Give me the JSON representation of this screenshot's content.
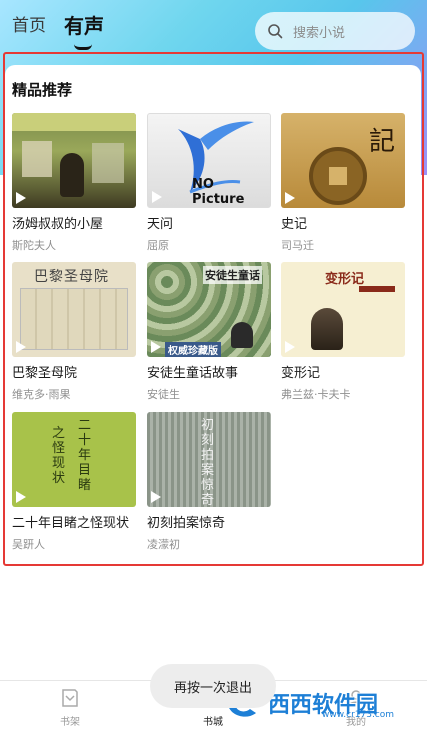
{
  "header": {
    "tab_home": "首页",
    "tab_audio": "有声",
    "search_placeholder": "搜索小说"
  },
  "section": {
    "title": "精品推荐"
  },
  "books": [
    {
      "title": "汤姆叔叔的小屋",
      "author": "斯陀夫人"
    },
    {
      "title": "天问",
      "author": "屈原",
      "cover_text": "NO Picture"
    },
    {
      "title": "史记",
      "author": "司马迁",
      "cover_text": "記"
    },
    {
      "title": "巴黎圣母院",
      "author": "维克多·雨果",
      "cover_text": "巴黎圣母院"
    },
    {
      "title": "安徒生童话故事",
      "author": "安徒生",
      "cover_text": "安徒生童话",
      "cover_subtext": "权威珍藏版"
    },
    {
      "title": "变形记",
      "author": "弗兰兹·卡夫卡",
      "cover_text": "变形记"
    },
    {
      "title": "二十年目睹之怪现状",
      "author": "吴趼人",
      "cover_text_1": "二十年目睹",
      "cover_text_2": "之怪现状"
    },
    {
      "title": "初刻拍案惊奇",
      "author": "凌濛初",
      "cover_text": "初刻拍案惊奇"
    }
  ],
  "toast": {
    "text": "再按一次退出"
  },
  "bottom_nav": {
    "bookshelf": "书架",
    "bookstore": "书城",
    "mine": "我的"
  },
  "watermark": {
    "text": "西西软件园",
    "url": "www.cr173.com"
  },
  "colors": {
    "highlight_border": "#e53935",
    "header_gradient_start": "#a8e6ff",
    "header_gradient_end": "#9d8ff6"
  }
}
